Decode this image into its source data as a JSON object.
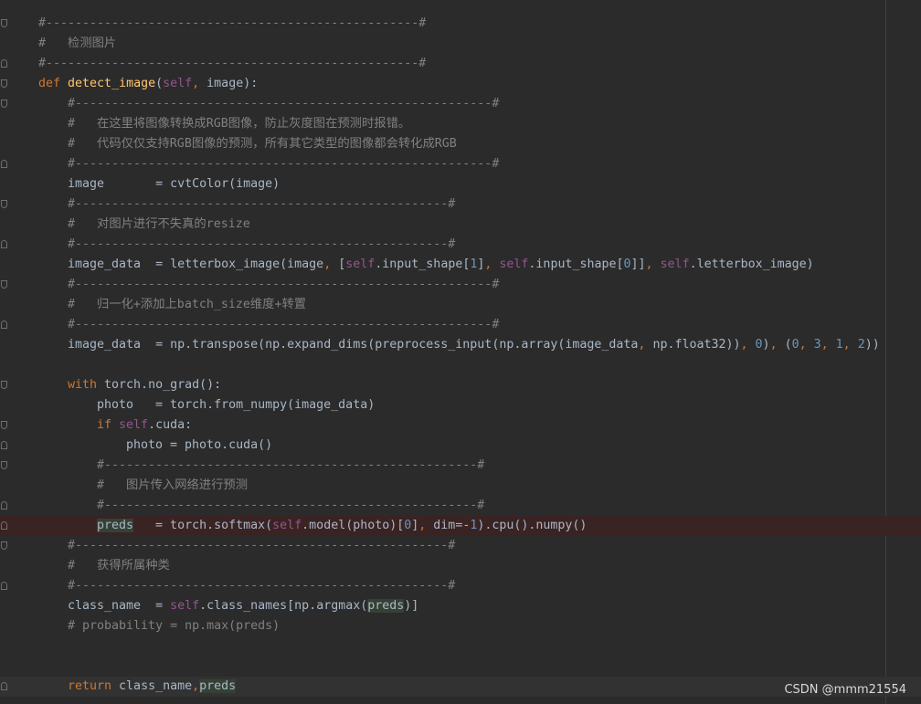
{
  "editor": {
    "lines": [
      {
        "indent": 0,
        "parts": [
          {
            "t": "#---------------------------------------------------#",
            "c": "cm"
          }
        ],
        "fold": "down"
      },
      {
        "indent": 0,
        "parts": [
          {
            "t": "#   检测图片",
            "c": "cm"
          }
        ],
        "fold": ""
      },
      {
        "indent": 0,
        "parts": [
          {
            "t": "#---------------------------------------------------#",
            "c": "cm"
          }
        ],
        "fold": "up"
      },
      {
        "indent": 0,
        "parts": [
          {
            "t": "def ",
            "c": "kw"
          },
          {
            "t": "detect_image",
            "c": "fn"
          },
          {
            "t": "(",
            "c": ""
          },
          {
            "t": "self",
            "c": "self"
          },
          {
            "t": ", ",
            "c": "kw"
          },
          {
            "t": "image):",
            "c": ""
          }
        ],
        "fold": "down"
      },
      {
        "indent": 1,
        "parts": [
          {
            "t": "#---------------------------------------------------------#",
            "c": "cm"
          }
        ],
        "fold": "down"
      },
      {
        "indent": 1,
        "parts": [
          {
            "t": "#   在这里将图像转换成RGB图像，防止灰度图在预测时报错。",
            "c": "cm"
          }
        ],
        "fold": ""
      },
      {
        "indent": 1,
        "parts": [
          {
            "t": "#   代码仅仅支持RGB图像的预测，所有其它类型的图像都会转化成RGB",
            "c": "cm"
          }
        ],
        "fold": ""
      },
      {
        "indent": 1,
        "parts": [
          {
            "t": "#---------------------------------------------------------#",
            "c": "cm"
          }
        ],
        "fold": "up"
      },
      {
        "indent": 1,
        "parts": [
          {
            "t": "image       = cvtColor(image)",
            "c": ""
          }
        ],
        "fold": ""
      },
      {
        "indent": 1,
        "parts": [
          {
            "t": "#---------------------------------------------------#",
            "c": "cm"
          }
        ],
        "fold": "down"
      },
      {
        "indent": 1,
        "parts": [
          {
            "t": "#   对图片进行不失真的resize",
            "c": "cm"
          }
        ],
        "fold": ""
      },
      {
        "indent": 1,
        "parts": [
          {
            "t": "#---------------------------------------------------#",
            "c": "cm"
          }
        ],
        "fold": "up"
      },
      {
        "indent": 1,
        "parts": [
          {
            "t": "image_data  = letterbox_image(image",
            "c": ""
          },
          {
            "t": ", ",
            "c": "kw"
          },
          {
            "t": "[",
            "c": ""
          },
          {
            "t": "self",
            "c": "self"
          },
          {
            "t": ".input_shape[",
            "c": ""
          },
          {
            "t": "1",
            "c": "num"
          },
          {
            "t": "]",
            "c": ""
          },
          {
            "t": ", ",
            "c": "kw"
          },
          {
            "t": "self",
            "c": "self"
          },
          {
            "t": ".input_shape[",
            "c": ""
          },
          {
            "t": "0",
            "c": "num"
          },
          {
            "t": "]]",
            "c": ""
          },
          {
            "t": ", ",
            "c": "kw"
          },
          {
            "t": "self",
            "c": "self"
          },
          {
            "t": ".letterbox_image)",
            "c": ""
          }
        ],
        "fold": ""
      },
      {
        "indent": 1,
        "parts": [
          {
            "t": "#---------------------------------------------------------#",
            "c": "cm"
          }
        ],
        "fold": "down"
      },
      {
        "indent": 1,
        "parts": [
          {
            "t": "#   归一化+添加上batch_size维度+转置",
            "c": "cm"
          }
        ],
        "fold": ""
      },
      {
        "indent": 1,
        "parts": [
          {
            "t": "#---------------------------------------------------------#",
            "c": "cm"
          }
        ],
        "fold": "up"
      },
      {
        "indent": 1,
        "parts": [
          {
            "t": "image_data  = np.transpose(np.expand_dims(preprocess_input(np.array(image_data",
            "c": ""
          },
          {
            "t": ", ",
            "c": "kw"
          },
          {
            "t": "np.float32))",
            "c": ""
          },
          {
            "t": ", ",
            "c": "kw"
          },
          {
            "t": "0",
            "c": "num"
          },
          {
            "t": ")",
            "c": ""
          },
          {
            "t": ", ",
            "c": "kw"
          },
          {
            "t": "(",
            "c": ""
          },
          {
            "t": "0",
            "c": "num"
          },
          {
            "t": ", ",
            "c": "kw"
          },
          {
            "t": "3",
            "c": "num"
          },
          {
            "t": ", ",
            "c": "kw"
          },
          {
            "t": "1",
            "c": "num"
          },
          {
            "t": ", ",
            "c": "kw"
          },
          {
            "t": "2",
            "c": "num"
          },
          {
            "t": "))",
            "c": ""
          }
        ],
        "fold": ""
      },
      {
        "indent": 1,
        "parts": [],
        "fold": ""
      },
      {
        "indent": 1,
        "parts": [
          {
            "t": "with ",
            "c": "kw"
          },
          {
            "t": "torch.no_grad():",
            "c": ""
          }
        ],
        "fold": "down"
      },
      {
        "indent": 2,
        "parts": [
          {
            "t": "photo   = torch.from_numpy(image_data)",
            "c": ""
          }
        ],
        "fold": ""
      },
      {
        "indent": 2,
        "parts": [
          {
            "t": "if ",
            "c": "kw"
          },
          {
            "t": "self",
            "c": "self"
          },
          {
            "t": ".cuda:",
            "c": ""
          }
        ],
        "fold": "down"
      },
      {
        "indent": 3,
        "parts": [
          {
            "t": "photo = photo.cuda()",
            "c": ""
          }
        ],
        "fold": "up"
      },
      {
        "indent": 2,
        "parts": [
          {
            "t": "#---------------------------------------------------#",
            "c": "cm"
          }
        ],
        "fold": "down"
      },
      {
        "indent": 2,
        "parts": [
          {
            "t": "#   图片传入网络进行预测",
            "c": "cm"
          }
        ],
        "fold": ""
      },
      {
        "indent": 2,
        "parts": [
          {
            "t": "#---------------------------------------------------#",
            "c": "cm"
          }
        ],
        "fold": "up"
      },
      {
        "indent": 2,
        "parts": [
          {
            "t": "preds",
            "c": "hl"
          },
          {
            "t": "   = torch.softmax(",
            "c": ""
          },
          {
            "t": "self",
            "c": "self"
          },
          {
            "t": ".model(photo)[",
            "c": ""
          },
          {
            "t": "0",
            "c": "num"
          },
          {
            "t": "]",
            "c": ""
          },
          {
            "t": ", ",
            "c": "kw"
          },
          {
            "t": "dim",
            "c": "param"
          },
          {
            "t": "=-",
            "c": ""
          },
          {
            "t": "1",
            "c": "num"
          },
          {
            "t": ").cpu().numpy()",
            "c": ""
          }
        ],
        "fold": "up",
        "style": "breakpoint"
      },
      {
        "indent": 1,
        "parts": [
          {
            "t": "#---------------------------------------------------#",
            "c": "cm"
          }
        ],
        "fold": "down"
      },
      {
        "indent": 1,
        "parts": [
          {
            "t": "#   获得所属种类",
            "c": "cm"
          }
        ],
        "fold": ""
      },
      {
        "indent": 1,
        "parts": [
          {
            "t": "#---------------------------------------------------#",
            "c": "cm"
          }
        ],
        "fold": "up"
      },
      {
        "indent": 1,
        "parts": [
          {
            "t": "class_name  = ",
            "c": ""
          },
          {
            "t": "self",
            "c": "self"
          },
          {
            "t": ".class_names[np.argmax(",
            "c": ""
          },
          {
            "t": "preds",
            "c": "hl"
          },
          {
            "t": ")]",
            "c": ""
          }
        ],
        "fold": ""
      },
      {
        "indent": 1,
        "parts": [
          {
            "t": "# probability = np.max(preds)",
            "c": "cm"
          }
        ],
        "fold": ""
      },
      {
        "indent": 1,
        "parts": [],
        "fold": ""
      },
      {
        "indent": 1,
        "parts": [],
        "fold": ""
      },
      {
        "indent": 1,
        "parts": [
          {
            "t": "return ",
            "c": "kw"
          },
          {
            "t": "class_name",
            "c": ""
          },
          {
            "t": ",",
            "c": "kw"
          },
          {
            "t": "preds",
            "c": "hl"
          }
        ],
        "fold": "up",
        "style": "current"
      }
    ]
  },
  "watermark": "CSDN @mmm21554",
  "colors": {
    "background": "#2b2b2b",
    "keyword": "#cc7832",
    "comment": "#808080",
    "number": "#6897bb",
    "self": "#94558d",
    "function": "#ffc66d",
    "text": "#a9b7c6"
  }
}
